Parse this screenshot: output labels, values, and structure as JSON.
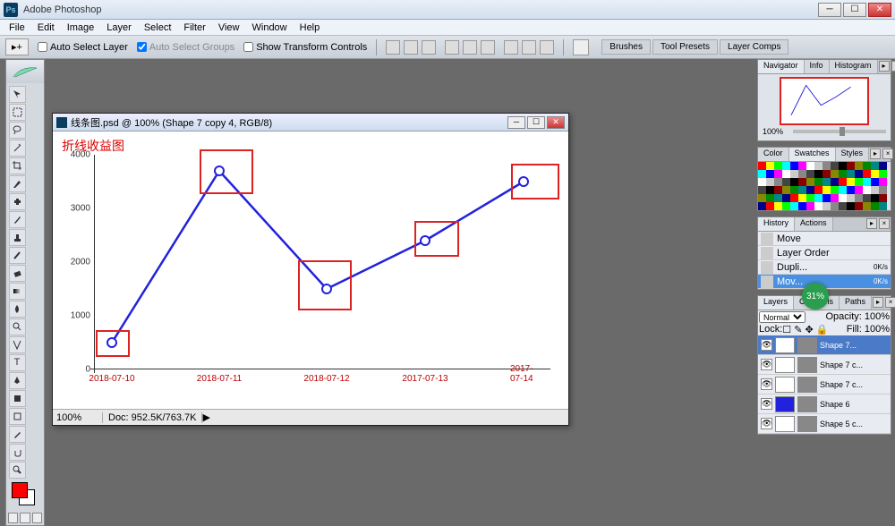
{
  "app": {
    "title": "Adobe Photoshop"
  },
  "menu": [
    "File",
    "Edit",
    "Image",
    "Layer",
    "Select",
    "Filter",
    "View",
    "Window",
    "Help"
  ],
  "options": {
    "tool": "▸+",
    "auto_select": "Auto Select Layer",
    "auto_groups": "Auto Select Groups",
    "show_transform": "Show Transform Controls",
    "dock_tabs": [
      "Brushes",
      "Tool Presets",
      "Layer Comps"
    ]
  },
  "doc": {
    "title": "线条图.psd @ 100% (Shape 7 copy 4, RGB/8)",
    "zoom": "100%",
    "docsize": "Doc: 952.5K/763.7K"
  },
  "chart_data": {
    "type": "line",
    "title": "折线收益图",
    "categories": [
      "2018-07-10",
      "2018-07-11",
      "2018-07-12",
      "2017-07-13",
      "2017-07-14"
    ],
    "values": [
      500,
      3700,
      1500,
      2400,
      3500
    ],
    "ylabel": "",
    "xlabel": "",
    "ylim": [
      0,
      4000
    ],
    "yticks": [
      0,
      1000,
      2000,
      3000,
      4000
    ]
  },
  "navigator": {
    "tabs": [
      "Navigator",
      "Info",
      "Histogram"
    ],
    "zoom": "100%"
  },
  "color": {
    "tabs": [
      "Color",
      "Swatches",
      "Styles"
    ]
  },
  "history": {
    "tabs": [
      "History",
      "Actions"
    ],
    "items": [
      "Move",
      "Layer Order",
      "Dupli...",
      "Mov..."
    ],
    "rate": "0K/s"
  },
  "layers": {
    "tabs": [
      "Layers",
      "Channels",
      "Paths"
    ],
    "blend": "Normal",
    "opacity": "Opacity: 100%",
    "lock": "Lock:",
    "fill": "Fill: 100%",
    "items": [
      "Shape 7...",
      "Shape 7 c...",
      "Shape 7 c...",
      "Shape 6",
      "Shape 5 c..."
    ]
  },
  "progress": "31%"
}
